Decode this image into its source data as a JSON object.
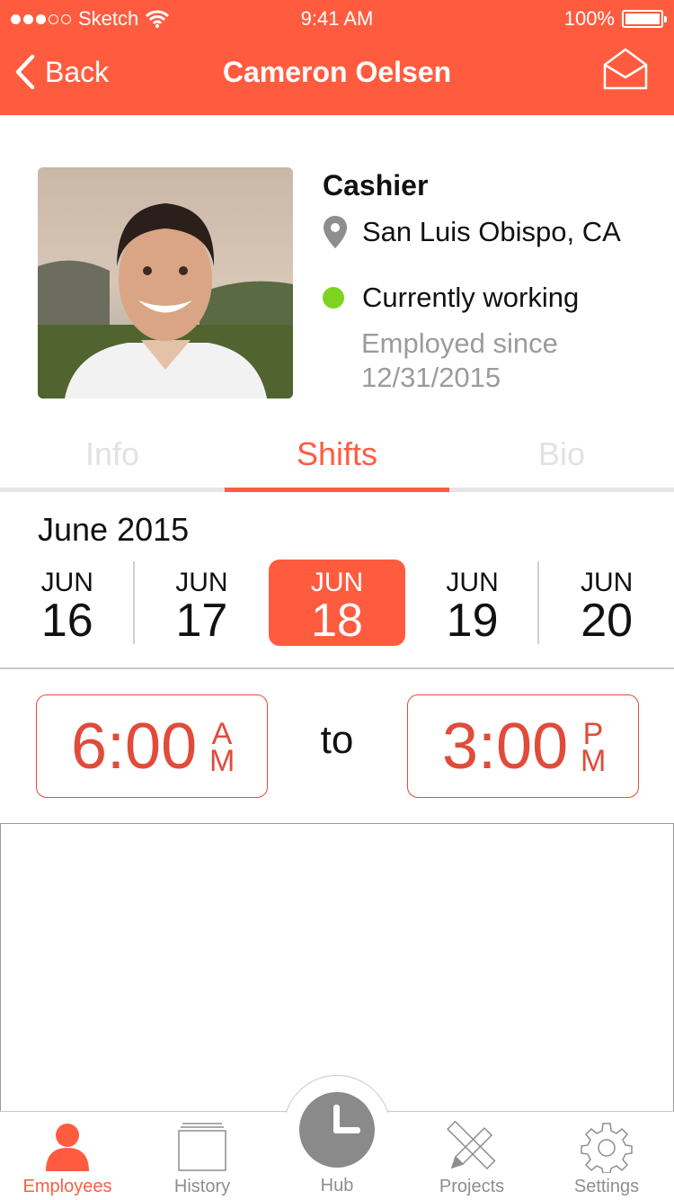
{
  "status_bar": {
    "carrier": "Sketch",
    "time": "9:41 AM",
    "battery": "100%"
  },
  "nav": {
    "back_label": "Back",
    "title": "Cameron Oelsen"
  },
  "profile": {
    "role": "Cashier",
    "location": "San Luis Obispo, CA",
    "status": "Currently working",
    "employed_since_label": "Employed since",
    "employed_since_date": "12/31/2015"
  },
  "tabs": [
    {
      "label": "Info",
      "active": false
    },
    {
      "label": "Shifts",
      "active": true
    },
    {
      "label": "Bio",
      "active": false
    }
  ],
  "calendar": {
    "month_label": "June 2015",
    "days": [
      {
        "month": "JUN",
        "day": "16"
      },
      {
        "month": "JUN",
        "day": "17"
      },
      {
        "month": "JUN",
        "day": "18",
        "selected": true
      },
      {
        "month": "JUN",
        "day": "19"
      },
      {
        "month": "JUN",
        "day": "20"
      }
    ]
  },
  "shift": {
    "start_time": "6:00",
    "start_ampm": [
      "A",
      "M"
    ],
    "to_label": "to",
    "end_time": "3:00",
    "end_ampm": [
      "P",
      "M"
    ]
  },
  "tabbar": [
    {
      "label": "Employees",
      "icon": "person-icon",
      "active": true
    },
    {
      "label": "History",
      "icon": "stack-icon",
      "active": false
    },
    {
      "label": "Hub",
      "icon": "clock-icon",
      "active": false
    },
    {
      "label": "Projects",
      "icon": "tools-icon",
      "active": false
    },
    {
      "label": "Settings",
      "icon": "gear-icon",
      "active": false
    }
  ],
  "colors": {
    "accent": "#ff5c3f",
    "working_dot": "#7ed321",
    "muted_text": "#9b9b9b"
  }
}
